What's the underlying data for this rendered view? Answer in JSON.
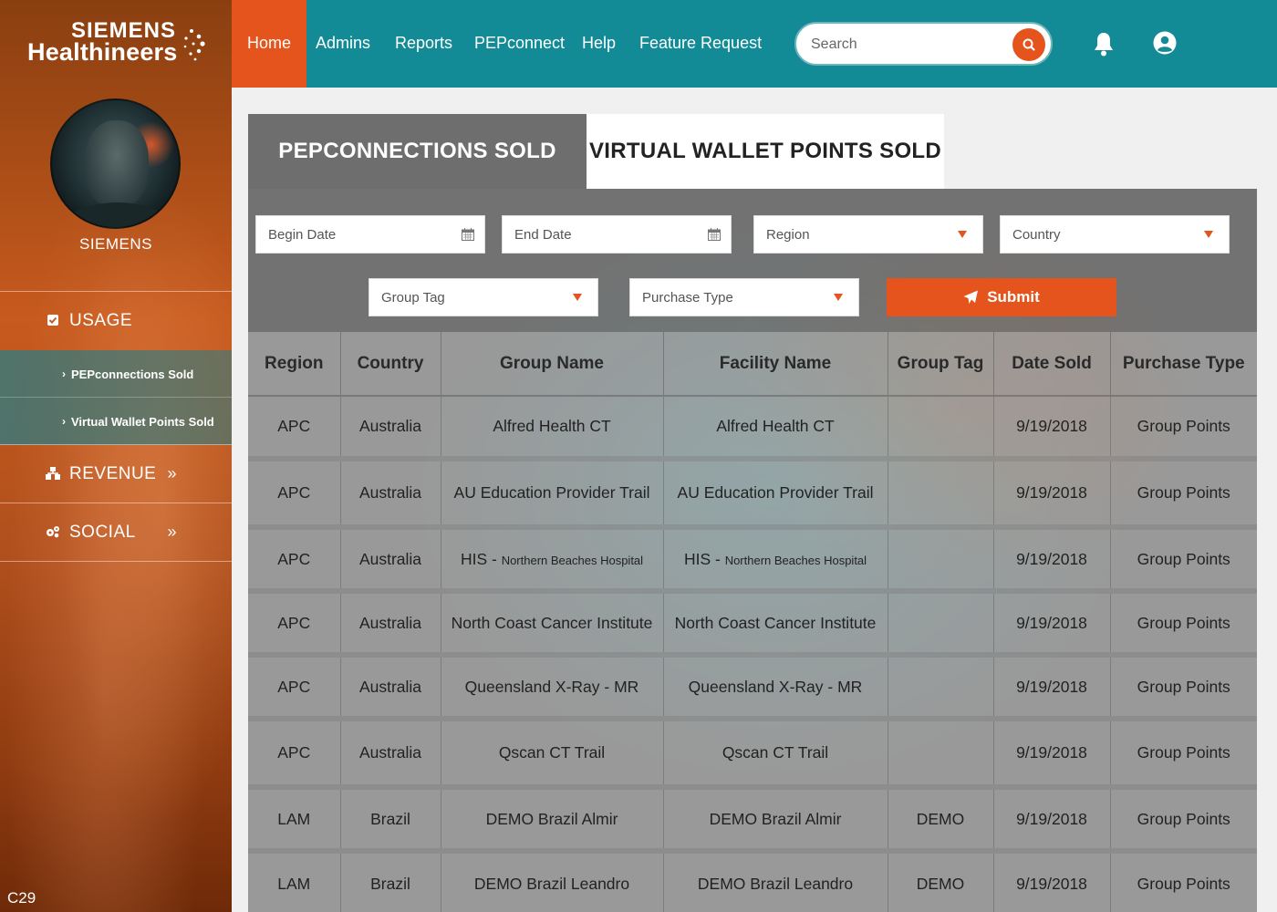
{
  "brand": {
    "line1": "SIEMENS",
    "line2": "Healthineers"
  },
  "user": {
    "name": "SIEMENS"
  },
  "corner_code": "C29",
  "sidebar": {
    "usage": {
      "label": "USAGE",
      "icon": "check-square-icon"
    },
    "usage_items": [
      {
        "label": "PEPconnections Sold"
      },
      {
        "label": "Virtual Wallet Points Sold"
      }
    ],
    "revenue": {
      "label": "REVENUE",
      "icon": "sitemap-icon",
      "chevron": "»"
    },
    "social": {
      "label": "SOCIAL",
      "icon": "cogs-icon",
      "chevron": "»"
    }
  },
  "nav": {
    "items": [
      "Home",
      "Admins",
      "Reports",
      "PEPconnect",
      "Help",
      "Feature Request"
    ],
    "active": "Home",
    "search_placeholder": "Search"
  },
  "tabs": [
    "PEPCONNECTIONS SOLD",
    "VIRTUAL WALLET POINTS SOLD"
  ],
  "filters": {
    "begin_date": "Begin Date",
    "end_date": "End Date",
    "region": "Region",
    "country": "Country",
    "group_tag": "Group Tag",
    "purchase_type": "Purchase Type",
    "submit": "Submit"
  },
  "colors": {
    "accent": "#e5541c",
    "nav_bg": "#138b96"
  },
  "table": {
    "columns": [
      "Region",
      "Country",
      "Group Name",
      "Facility Name",
      "Group Tag",
      "Date Sold",
      "Purchase Type"
    ],
    "rows": [
      {
        "region": "APC",
        "country": "Australia",
        "group": "Alfred Health CT",
        "facility": "Alfred Health CT",
        "tag": "",
        "date": "9/19/2018",
        "type": "Group Points"
      },
      {
        "region": "APC",
        "country": "Australia",
        "group": "AU Education Provider Trail",
        "facility": "AU Education Provider Trail",
        "tag": "",
        "date": "9/19/2018",
        "type": "Group Points"
      },
      {
        "region": "APC",
        "country": "Australia",
        "group_prefix": "HIS  -",
        "group_small": "Northern Beaches Hospital",
        "facility_prefix": "HIS  -",
        "facility_small": "Northern Beaches Hospital",
        "tag": "",
        "date": "9/19/2018",
        "type": "Group Points"
      },
      {
        "region": "APC",
        "country": "Australia",
        "group": "North Coast Cancer Institute",
        "facility": "North Coast Cancer Institute",
        "tag": "",
        "date": "9/19/2018",
        "type": "Group Points"
      },
      {
        "region": "APC",
        "country": "Australia",
        "group": "Queensland X-Ray - MR",
        "facility": "Queensland X-Ray - MR",
        "tag": "",
        "date": "9/19/2018",
        "type": "Group Points"
      },
      {
        "region": "APC",
        "country": "Australia",
        "group": "Qscan CT Trail",
        "facility": "Qscan CT Trail",
        "tag": "",
        "date": "9/19/2018",
        "type": "Group Points"
      },
      {
        "region": "LAM",
        "country": "Brazil",
        "group": "DEMO Brazil Almir",
        "facility": "DEMO Brazil Almir",
        "tag": "DEMO",
        "date": "9/19/2018",
        "type": "Group Points"
      },
      {
        "region": "LAM",
        "country": "Brazil",
        "group": "DEMO Brazil Leandro",
        "facility": "DEMO Brazil Leandro",
        "tag": "DEMO",
        "date": "9/19/2018",
        "type": "Group Points"
      }
    ]
  }
}
